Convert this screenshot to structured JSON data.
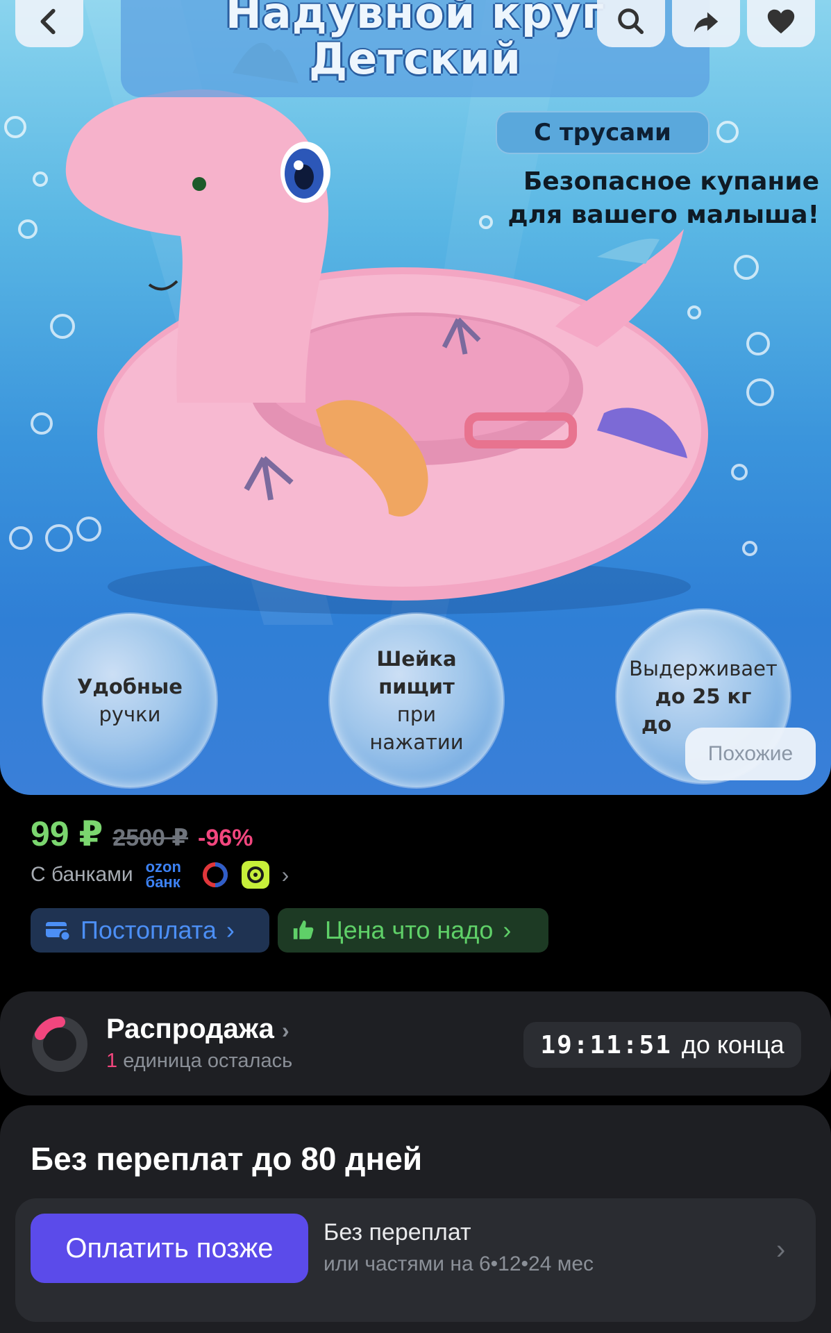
{
  "hero": {
    "title_line1": "Надувной круг",
    "title_line2": "Детский",
    "badge": "С трусами",
    "subtitle_line1": "Безопасное купание",
    "subtitle_line2": "для вашего малыша!",
    "bubbles": [
      {
        "line1": "Удобные",
        "line2": "ручки"
      },
      {
        "line1": "Шейка",
        "line2": "пищит",
        "line3": "при",
        "line4": "нажатии"
      },
      {
        "line1": "Выдерживает",
        "line2": "до 25 кг",
        "line3": "до"
      }
    ],
    "similar_label": "Похожие"
  },
  "top_buttons": {
    "back_icon": "chevron-left-icon",
    "search_icon": "search-icon",
    "share_icon": "share-icon",
    "favorite_icon": "heart-icon"
  },
  "price": {
    "current": "99 ₽",
    "old": "2500 ₽",
    "discount": "-96%",
    "banks_label": "С банками",
    "ozon_bank_line1": "ozon",
    "ozon_bank_line2": "банк",
    "colors": {
      "current": "#7bd66f",
      "discount": "#f2467e"
    }
  },
  "tags": {
    "postpay": "Постоплата",
    "fair_price": "Цена что надо"
  },
  "sale": {
    "title": "Распродажа",
    "remaining_count": "1",
    "remaining_text": "единица осталась",
    "timer": "19:11:51",
    "timer_suffix": "до конца"
  },
  "bnpl": {
    "title": "Без переплат до 80 дней",
    "button": "Оплатить позже",
    "line1": "Без переплат",
    "line2": "или частями на 6•12•24 мес",
    "accent": "#5b4bea"
  }
}
